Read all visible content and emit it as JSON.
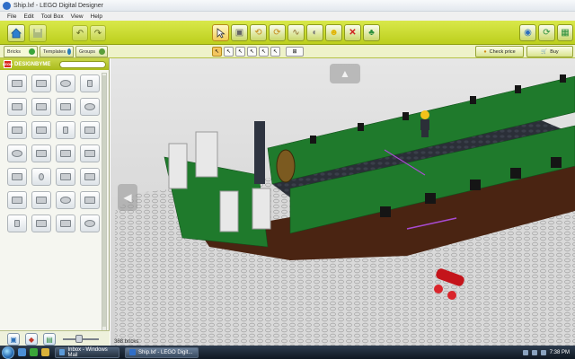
{
  "window": {
    "title": "Ship.lxf - LEGO Digital Designer"
  },
  "menu": [
    "File",
    "Edit",
    "Tool Box",
    "View",
    "Help"
  ],
  "tabs": [
    {
      "label": "Bricks",
      "icon": "brick-gem-icon"
    },
    {
      "label": "Templates",
      "icon": "template-icon"
    },
    {
      "label": "Groups",
      "icon": "groups-icon"
    }
  ],
  "palette": {
    "brand": "DESIGNBYME",
    "search_value": "",
    "brick_count": 28
  },
  "actions": {
    "check_price": "Check price",
    "buy": "Buy"
  },
  "toolbar_icons": [
    "home-icon",
    "save-icon",
    "undo-icon",
    "redo-icon",
    "select-icon",
    "clone-icon",
    "hinge-icon",
    "hinge-align-icon",
    "flex-icon",
    "paint-icon",
    "hide-icon",
    "delete-icon",
    "decorate-icon",
    "camera-mode-icon",
    "build-guide-icon",
    "view-mode-icon"
  ],
  "status": {
    "brick_count_text": "388 bricks"
  },
  "taskbar": {
    "tasks": [
      {
        "label": "Inbox - Windows Mail",
        "active": false
      },
      {
        "label": "Ship.lxf - LEGO Digit...",
        "active": true
      }
    ],
    "clock": "7:38 PM"
  },
  "colors": {
    "accent": "#c4d52a",
    "hull_green": "#1f7a2c",
    "deck": "#2a2f3a",
    "hull_brown": "#4a2412",
    "cannon": "#c4141b"
  }
}
